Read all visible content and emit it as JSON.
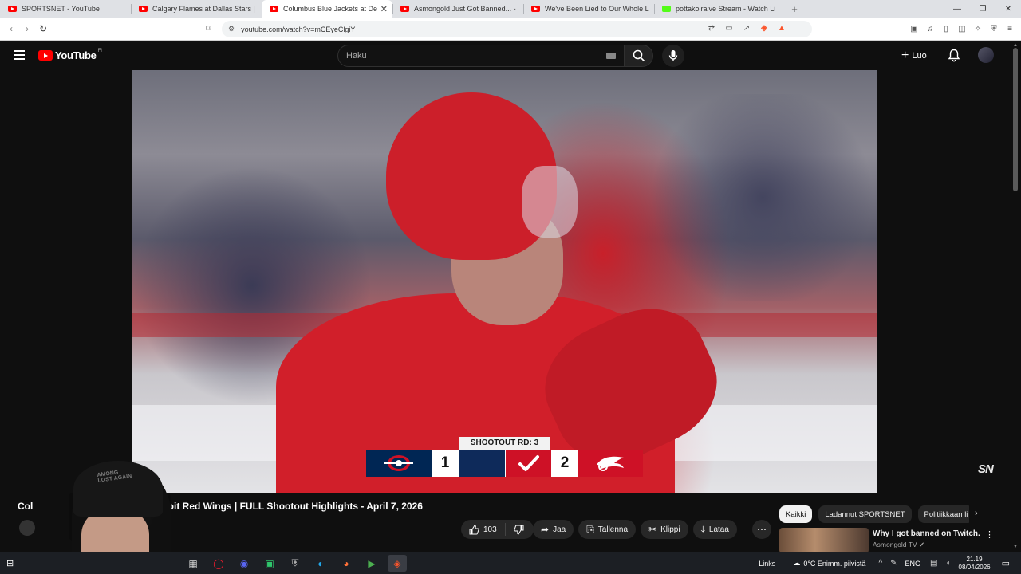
{
  "browser": {
    "tabs": [
      {
        "title": "SPORTSNET - YouTube",
        "favicon": "youtube-icon",
        "active": false
      },
      {
        "title": "Calgary Flames at Dallas Stars | FULL",
        "favicon": "youtube-icon",
        "active": false
      },
      {
        "title": "Columbus Blue Jackets at Detroit",
        "favicon": "youtube-icon",
        "active": true
      },
      {
        "title": "Asmongold Just Got Banned... - You",
        "favicon": "youtube-icon",
        "active": false
      },
      {
        "title": "We've Been Lied to Our Whole Lives",
        "favicon": "youtube-icon",
        "active": false
      },
      {
        "title": "pottakoiraive Stream - Watch Li",
        "favicon": "kick-icon",
        "active": false
      }
    ],
    "new_tab": "+",
    "url": "youtube.com/watch?v=mCEyeClgiY",
    "window_controls": {
      "minimize": "—",
      "maximize": "❐",
      "close": "✕"
    }
  },
  "youtube": {
    "logo_text": "YouTube",
    "country_code": "FI",
    "search_placeholder": "Haku",
    "create_label": "Luo"
  },
  "player": {
    "scorebug": {
      "label": "SHOOTOUT RD: 3",
      "away_score": "1",
      "home_score": "2",
      "away_color": "#002654",
      "home_color": "#ce1126"
    },
    "watermark": "SN"
  },
  "video": {
    "title_start": "Col",
    "title_end": "etroit Red Wings | FULL Shootout Highlights - April 7, 2026",
    "likes": "103",
    "share_label": "Jaa",
    "save_label": "Tallenna",
    "clip_label": "Klippi",
    "download_label": "Lataa",
    "overlay_cap_text": "AMONG\nLOST AGAIN"
  },
  "sidebar": {
    "chips": [
      "Kaikki",
      "Ladannut SPORTSNET",
      "Politiikkaan li"
    ],
    "recommendation": {
      "title": "Why I got banned on Twitch.",
      "channel": "Asmongold TV"
    }
  },
  "taskbar": {
    "links": "Links",
    "weather": "0°C  Enimm. pilvistä",
    "language": "ENG",
    "time": "21.19",
    "date": "08/04/2026"
  }
}
